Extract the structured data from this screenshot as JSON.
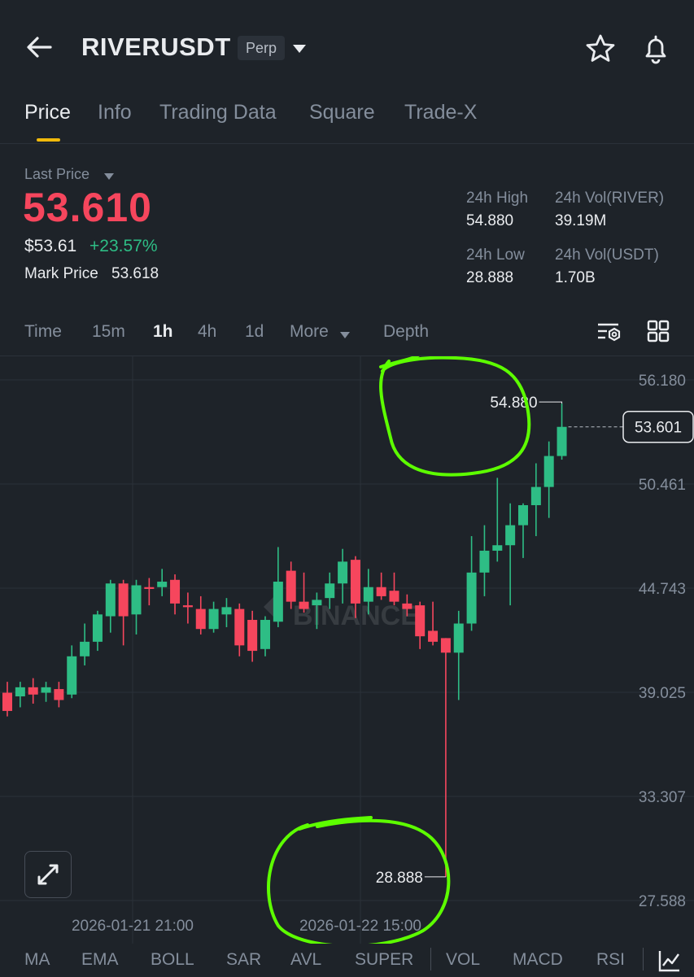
{
  "header": {
    "symbol": "RIVERUSDT",
    "badge": "Perp"
  },
  "tabs": [
    {
      "label": "Price",
      "active": true
    },
    {
      "label": "Info"
    },
    {
      "label": "Trading Data"
    },
    {
      "label": "Square"
    },
    {
      "label": "Trade-X"
    }
  ],
  "price": {
    "last_label": "Last Price",
    "last_price": "53.610",
    "usd_price": "$53.61",
    "change": "+23.57%",
    "mark_label": "Mark Price",
    "mark_value": "53.618"
  },
  "stats": {
    "high_label": "24h High",
    "high_value": "54.880",
    "vol_base_label": "24h Vol(RIVER)",
    "vol_base_value": "39.19M",
    "low_label": "24h Low",
    "low_value": "28.888",
    "vol_quote_label": "24h Vol(USDT)",
    "vol_quote_value": "1.70B"
  },
  "intervals": {
    "time": "Time",
    "m15": "15m",
    "h1": "1h",
    "h4": "4h",
    "d1": "1d",
    "more": "More",
    "depth": "Depth",
    "active": "1h"
  },
  "chart_data": {
    "type": "candlestick",
    "y_ticks": [
      "56.180",
      "50.461",
      "44.743",
      "39.025",
      "33.307",
      "27.588"
    ],
    "x_ticks": [
      "2026-01-21 21:00",
      "2026-01-22 15:00"
    ],
    "current_price_label": "53.601",
    "high_annotation": "54.880",
    "low_annotation": "28.888",
    "watermark": "BINANCE",
    "up_color": "#2ebd85",
    "down_color": "#f6465d",
    "candles": [
      {
        "o": 39.0,
        "h": 39.6,
        "l": 37.7,
        "c": 38.0
      },
      {
        "o": 38.8,
        "h": 39.6,
        "l": 38.2,
        "c": 39.3
      },
      {
        "o": 39.3,
        "h": 39.8,
        "l": 38.4,
        "c": 38.9
      },
      {
        "o": 39.0,
        "h": 39.6,
        "l": 38.5,
        "c": 39.3
      },
      {
        "o": 39.2,
        "h": 39.6,
        "l": 38.2,
        "c": 38.6
      },
      {
        "o": 38.9,
        "h": 41.6,
        "l": 38.7,
        "c": 41.0
      },
      {
        "o": 41.0,
        "h": 42.8,
        "l": 40.5,
        "c": 41.8
      },
      {
        "o": 41.8,
        "h": 43.5,
        "l": 41.3,
        "c": 43.3
      },
      {
        "o": 43.2,
        "h": 45.2,
        "l": 42.3,
        "c": 45.0
      },
      {
        "o": 45.0,
        "h": 45.2,
        "l": 41.6,
        "c": 43.2
      },
      {
        "o": 43.3,
        "h": 45.2,
        "l": 42.2,
        "c": 44.9
      },
      {
        "o": 44.8,
        "h": 45.3,
        "l": 43.8,
        "c": 44.7
      },
      {
        "o": 44.8,
        "h": 45.8,
        "l": 44.3,
        "c": 45.1
      },
      {
        "o": 45.2,
        "h": 45.5,
        "l": 43.3,
        "c": 43.9
      },
      {
        "o": 43.8,
        "h": 44.5,
        "l": 42.8,
        "c": 43.7
      },
      {
        "o": 43.6,
        "h": 44.3,
        "l": 42.2,
        "c": 42.5
      },
      {
        "o": 42.5,
        "h": 44.0,
        "l": 42.3,
        "c": 43.6
      },
      {
        "o": 43.3,
        "h": 44.2,
        "l": 42.6,
        "c": 43.7
      },
      {
        "o": 43.6,
        "h": 43.9,
        "l": 41.0,
        "c": 41.6
      },
      {
        "o": 43.0,
        "h": 43.5,
        "l": 40.7,
        "c": 41.3
      },
      {
        "o": 41.4,
        "h": 43.2,
        "l": 41.0,
        "c": 43.0
      },
      {
        "o": 42.9,
        "h": 47.0,
        "l": 42.6,
        "c": 45.1
      },
      {
        "o": 45.7,
        "h": 46.2,
        "l": 43.6,
        "c": 44.0
      },
      {
        "o": 44.0,
        "h": 45.6,
        "l": 43.4,
        "c": 43.6
      },
      {
        "o": 43.8,
        "h": 44.5,
        "l": 42.5,
        "c": 44.1
      },
      {
        "o": 44.2,
        "h": 45.6,
        "l": 43.6,
        "c": 45.0
      },
      {
        "o": 45.0,
        "h": 46.9,
        "l": 43.9,
        "c": 46.2
      },
      {
        "o": 46.3,
        "h": 46.5,
        "l": 43.1,
        "c": 43.9
      },
      {
        "o": 44.0,
        "h": 45.8,
        "l": 43.3,
        "c": 44.8
      },
      {
        "o": 44.8,
        "h": 45.6,
        "l": 44.1,
        "c": 44.3
      },
      {
        "o": 44.6,
        "h": 45.6,
        "l": 43.8,
        "c": 44.0
      },
      {
        "o": 43.9,
        "h": 44.4,
        "l": 43.2,
        "c": 43.6
      },
      {
        "o": 43.8,
        "h": 44.0,
        "l": 41.4,
        "c": 42.1
      },
      {
        "o": 42.4,
        "h": 44.0,
        "l": 41.6,
        "c": 41.8
      },
      {
        "o": 42.0,
        "h": 42.0,
        "l": 28.888,
        "c": 41.2
      },
      {
        "o": 41.2,
        "h": 43.5,
        "l": 38.6,
        "c": 42.8
      },
      {
        "o": 42.8,
        "h": 47.6,
        "l": 42.4,
        "c": 45.6
      },
      {
        "o": 45.6,
        "h": 48.2,
        "l": 44.3,
        "c": 46.8
      },
      {
        "o": 46.8,
        "h": 50.8,
        "l": 46.2,
        "c": 47.1
      },
      {
        "o": 47.1,
        "h": 49.4,
        "l": 43.8,
        "c": 48.2
      },
      {
        "o": 48.2,
        "h": 49.4,
        "l": 46.4,
        "c": 49.3
      },
      {
        "o": 49.3,
        "h": 51.6,
        "l": 47.6,
        "c": 50.3
      },
      {
        "o": 50.3,
        "h": 52.8,
        "l": 48.6,
        "c": 52.0
      },
      {
        "o": 52.0,
        "h": 54.88,
        "l": 51.8,
        "c": 53.601
      }
    ]
  },
  "indicators": [
    "MA",
    "EMA",
    "BOLL",
    "SAR",
    "AVL",
    "SUPER",
    "VOL",
    "MACD",
    "RSI"
  ]
}
